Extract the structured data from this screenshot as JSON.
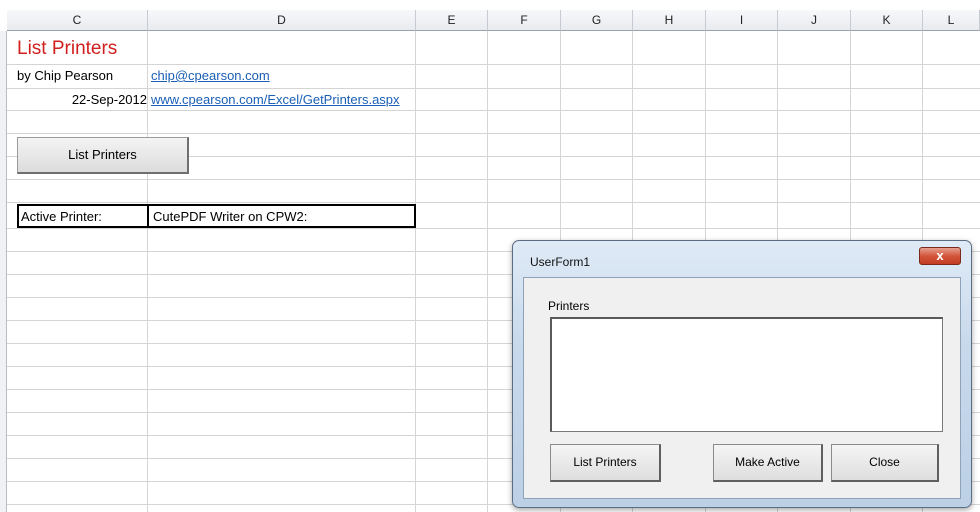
{
  "columns": [
    "C",
    "D",
    "E",
    "F",
    "G",
    "H",
    "I",
    "J",
    "K",
    "L"
  ],
  "sheet": {
    "title": "List Printers",
    "author": "by Chip Pearson",
    "email": "chip@cpearson.com",
    "date": "22-Sep-2012",
    "url": "www.cpearson.com/Excel/GetPrinters.aspx",
    "list_button_label": "List Printers",
    "active_printer_label": "Active Printer:",
    "active_printer_value": "CutePDF Writer on CPW2:"
  },
  "dialog": {
    "title": "UserForm1",
    "close_glyph": "x",
    "printers_label": "Printers",
    "printers": [],
    "list_button": "List Printers",
    "make_active_button": "Make Active",
    "close_button": "Close"
  },
  "colors": {
    "title_red": "#d11f1f",
    "link_blue": "#1a5fb4",
    "close_red": "#c23c22"
  }
}
